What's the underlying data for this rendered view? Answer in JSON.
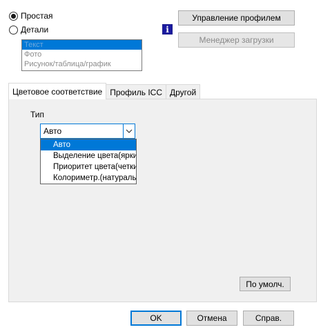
{
  "mode": {
    "options": [
      {
        "label": "Простая",
        "checked": true
      },
      {
        "label": "Детали",
        "checked": false
      }
    ]
  },
  "listbox": {
    "items": [
      "Текст",
      "Фото",
      "Рисунок/таблица/график"
    ],
    "selected_index": 0
  },
  "buttons": {
    "profile_management": "Управление профилем",
    "download_manager": "Менеджер загрузки",
    "defaults": "По умолч.",
    "ok": "OK",
    "cancel": "Отмена",
    "help": "Справ."
  },
  "info_icon": "i",
  "tabs": [
    {
      "label": "Цветовое соответствие",
      "active": true
    },
    {
      "label": "Профиль ICC",
      "active": false
    },
    {
      "label": "Другой",
      "active": false
    }
  ],
  "type_section": {
    "label": "Тип",
    "value": "Авто",
    "options": [
      "Авто",
      "Выделение цвета(яркий)",
      "Приоритет цвета(четкий)",
      "Колориметр.(натуральный)"
    ],
    "selected_index": 0
  },
  "colors": {
    "accent": "#0078d7",
    "panel": "#f0f0f0",
    "button": "#e1e1e1"
  }
}
